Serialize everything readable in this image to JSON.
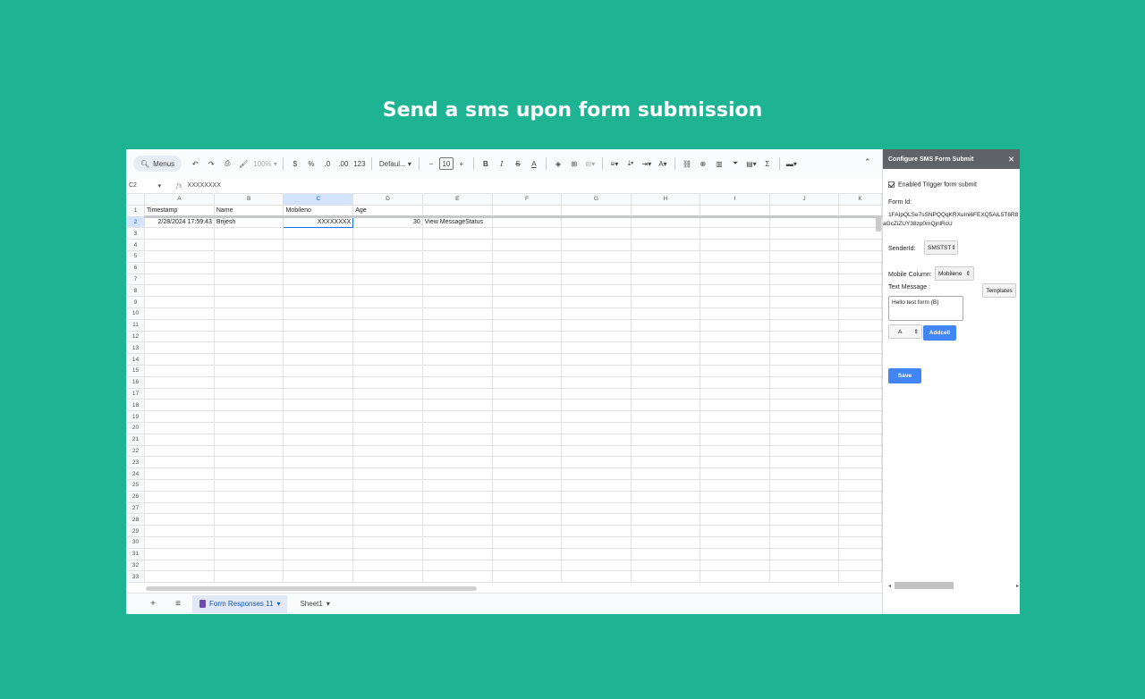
{
  "headline": "Send a sms upon form submission",
  "toolbar": {
    "menus": "Menus",
    "zoom": "100%",
    "currency": "$",
    "percent": "%",
    "decrease_decimal": ".0",
    "increase_decimal": ".00",
    "number_format": "123",
    "font": "Defaul...",
    "font_size": "10",
    "minus": "−",
    "plus": "+",
    "bold": "B",
    "italic": "I",
    "strike": "S",
    "text_color": "A",
    "collapse": "⌃"
  },
  "formula_bar": {
    "cell_ref": "C2",
    "fx": "fx",
    "value": "XXXXXXXX"
  },
  "grid": {
    "columns": [
      "A",
      "B",
      "C",
      "D",
      "E",
      "F",
      "G",
      "H",
      "I",
      "J",
      "K"
    ],
    "selected_column": "C",
    "header_row": [
      "Timestamp",
      "Name",
      "Mobileno",
      "Age",
      "",
      "",
      "",
      "",
      "",
      "",
      ""
    ],
    "data_row": [
      "2/28/2024 17:59:43",
      "Brijesh",
      "XXXXXXXX",
      "30",
      "View MessageStatus",
      "",
      "",
      "",
      "",
      "",
      ""
    ],
    "row_numbers": [
      "1",
      "2",
      "3",
      "4",
      "5",
      "6",
      "7",
      "8",
      "9",
      "10",
      "11",
      "12",
      "13",
      "14",
      "15",
      "16",
      "17",
      "18",
      "19",
      "20",
      "21",
      "22",
      "23",
      "24",
      "25",
      "26",
      "27",
      "28",
      "29",
      "30",
      "31",
      "32",
      "33"
    ]
  },
  "sheets": {
    "add": "+",
    "menu": "≡",
    "tabs": [
      {
        "label": "Form Responses 11",
        "active": true
      },
      {
        "label": "Sheet1",
        "active": false
      }
    ]
  },
  "panel": {
    "title": "Configure SMS Form Submit",
    "close": "×",
    "enabled_label": "Enabled Trigger form submit",
    "form_id_label": "Form Id:",
    "form_id_line1": "1FAIpQLSe7sSNPQQqKRXuIni6FEXQ5AiL5T6R8",
    "form_id_line2": "aGcZiZUY38zp0mQjnlRcU",
    "sender_label": "SenderId:",
    "sender_value": "SMSTST",
    "mobile_col_label": "Mobile Column:",
    "mobile_col_value": "Mobileno",
    "text_msg_label": "Text Message :",
    "templates_btn": "Templates",
    "message_text": "Hello test form {B}",
    "column_select": "A",
    "addcell_btn": "Addcell",
    "save_btn": "Save"
  },
  "colors": {
    "background": "#1db393",
    "accent_blue": "#4285f4",
    "panel_header": "#5f6368"
  }
}
